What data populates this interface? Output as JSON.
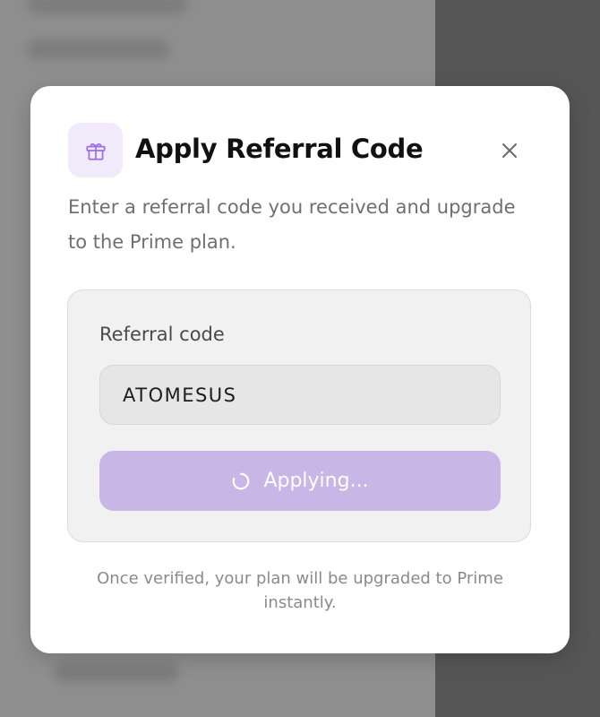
{
  "modal": {
    "title": "Apply Referral Code",
    "description": "Enter a referral code you received and upgrade to the Prime plan.",
    "header_icon": "gift-icon",
    "close_icon": "close-icon",
    "form": {
      "label": "Referral code",
      "input_value": "ATOMESUS",
      "button_label": "Applying...",
      "button_icon": "spinner-icon",
      "button_state": "loading"
    },
    "footnote": "Once verified, your plan will be upgraded to Prime instantly."
  },
  "colors": {
    "accent": "#8b5cf6",
    "accent_tint": "#f1eafb",
    "button_disabled": "#c8b6e6",
    "backdrop": "#8f8f8f"
  }
}
